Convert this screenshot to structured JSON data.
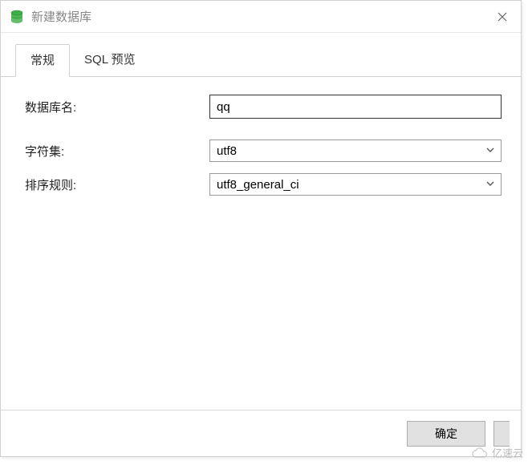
{
  "window": {
    "title": "新建数据库",
    "close_glyph": "✕"
  },
  "tabs": {
    "general": "常规",
    "sql_preview": "SQL 预览"
  },
  "form": {
    "db_name_label": "数据库名:",
    "db_name_value": "qq",
    "charset_label": "字符集:",
    "charset_value": "utf8",
    "collation_label": "排序规则:",
    "collation_value": "utf8_general_ci"
  },
  "footer": {
    "ok": "确定"
  },
  "watermark": {
    "text": "亿速云"
  },
  "icons": {
    "database": "database-icon",
    "chevron_down": "chevron-down-icon",
    "cloud": "cloud-icon"
  }
}
